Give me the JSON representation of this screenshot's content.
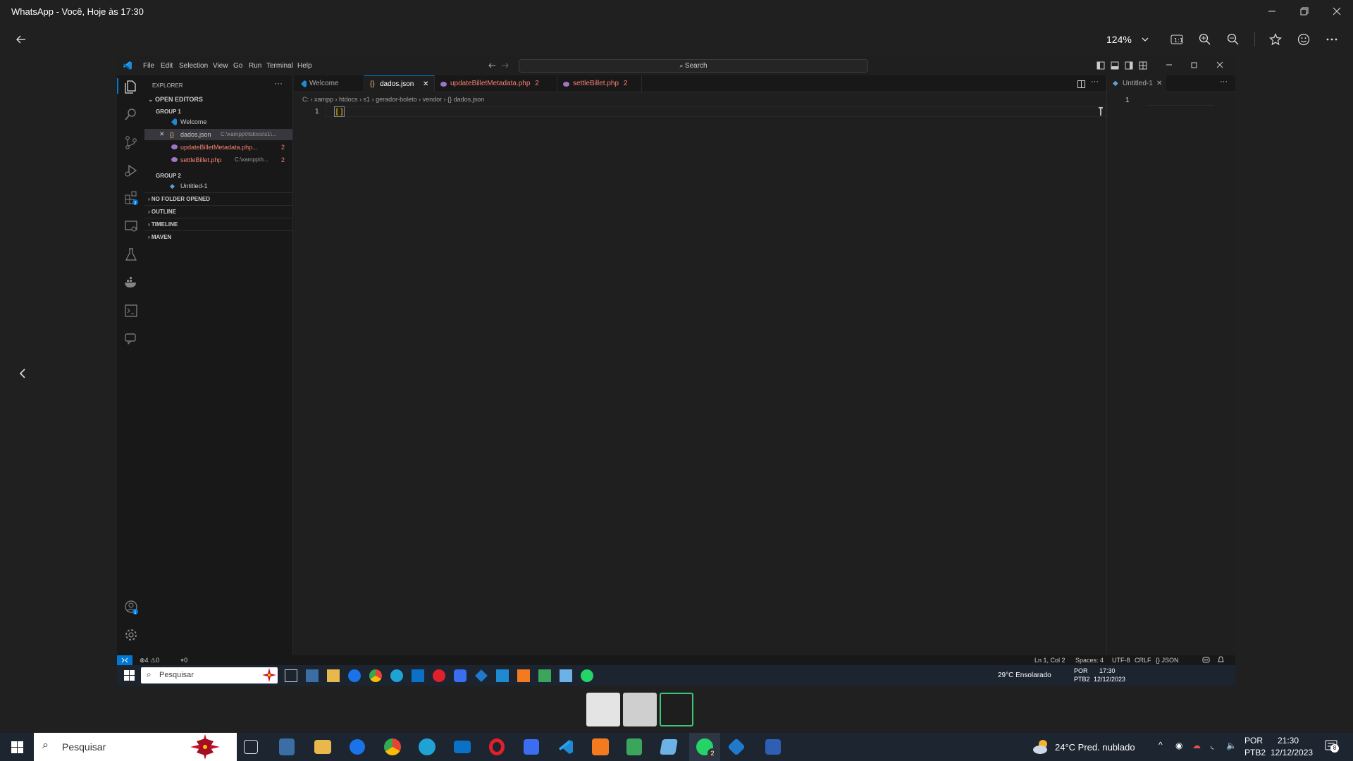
{
  "viewer": {
    "title": "WhatsApp - Você, Hoje às 17:30",
    "zoom": "124%"
  },
  "vscode": {
    "menu": [
      "File",
      "Edit",
      "Selection",
      "View",
      "Go",
      "Run",
      "Terminal",
      "Help"
    ],
    "search_placeholder": "Search",
    "sidebar": {
      "explorer_label": "EXPLORER",
      "open_editors": "OPEN EDITORS",
      "group1": "GROUP 1",
      "group2": "GROUP 2",
      "files": [
        {
          "name": "Welcome",
          "path": "",
          "badge": ""
        },
        {
          "name": "dados.json",
          "path": "C:\\xampp\\htdocs\\s1\\...",
          "badge": ""
        },
        {
          "name": "updateBilletMetadata.php...",
          "path": "",
          "badge": "2"
        },
        {
          "name": "settleBillet.php",
          "path": "C:\\xampp\\h...",
          "badge": "2"
        }
      ],
      "group2_file": "Untitled-1",
      "sections": [
        "NO FOLDER OPENED",
        "OUTLINE",
        "TIMELINE",
        "MAVEN"
      ]
    },
    "tabs": [
      {
        "label": "Welcome",
        "badge": ""
      },
      {
        "label": "dados.json",
        "badge": ""
      },
      {
        "label": "updateBilletMetadata.php",
        "badge": "2"
      },
      {
        "label": "settleBillet.php",
        "badge": "2"
      }
    ],
    "right_tab": "Untitled-1",
    "breadcrumb": [
      "C:",
      "xampp",
      "htdocs",
      "s1",
      "gerador-boleto",
      "vendor",
      "{} dados.json"
    ],
    "line_number": "1",
    "code": "[]",
    "right_line_number": "1",
    "status": {
      "errors": "4",
      "warnings": "0",
      "ports": "0",
      "position": "Ln 1, Col 2",
      "spaces": "Spaces: 4",
      "encoding": "UTF-8",
      "eol": "CRLF",
      "language": "{} JSON"
    },
    "inner_taskbar": {
      "search": "Pesquisar",
      "weather": "29°C  Ensolarado",
      "lang": "POR",
      "layout": "PTB2",
      "time": "17:30",
      "date": "12/12/2023"
    }
  },
  "taskbar": {
    "search": "Pesquisar",
    "weather": "24°C  Pred. nublado",
    "lang": "POR",
    "layout": "PTB2",
    "time": "21:30",
    "date": "12/12/2023",
    "notifications": "8",
    "whatsapp_badge": "2"
  }
}
